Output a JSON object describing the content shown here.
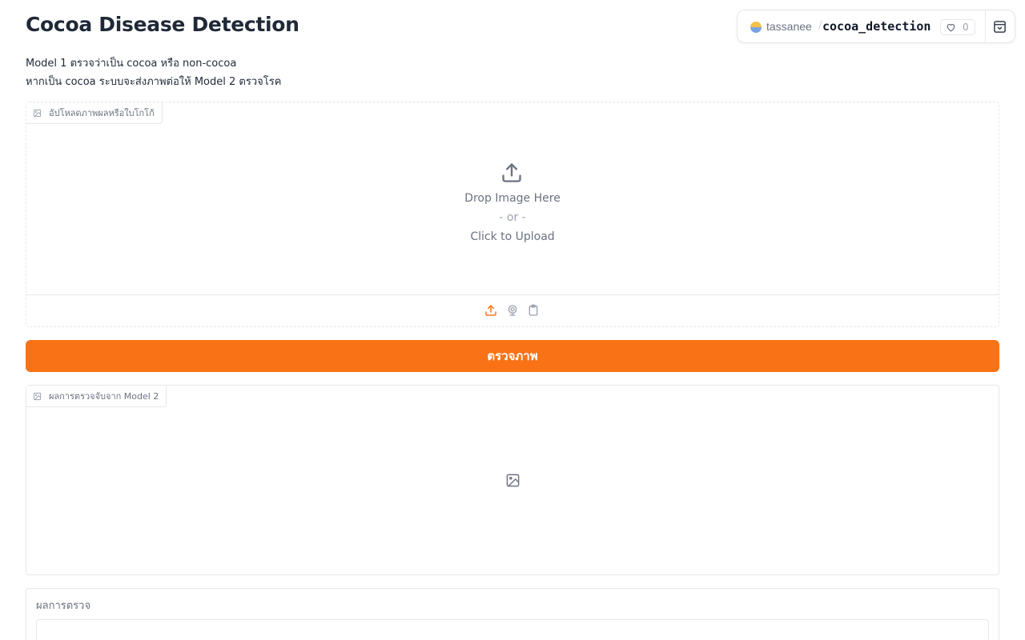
{
  "app": {
    "title": "Cocoa Disease Detection",
    "description_line1": "Model 1 ตรวจว่าเป็น cocoa หรือ non-cocoa",
    "description_line2": "หากเป็น cocoa ระบบจะส่งภาพต่อให้ Model 2 ตรวจโรค"
  },
  "space_badge": {
    "owner": "tassanee",
    "separator": "/",
    "repo": "cocoa_detection",
    "likes": "0"
  },
  "upload": {
    "label": "อัปโหลดภาพผลหรือใบโกโก้",
    "drop_text": "Drop Image Here",
    "or_text": "- or -",
    "click_text": "Click to Upload",
    "toolbar_icons": [
      "upload-icon",
      "webcam-icon",
      "clipboard-icon"
    ],
    "active_color": "#f97316"
  },
  "submit": {
    "label": "ตรวจภาพ",
    "color": "#f97316"
  },
  "output_image": {
    "label": "ผลการตรวจจับจาก Model 2"
  },
  "result": {
    "label": "ผลการตรวจ",
    "value": ""
  }
}
